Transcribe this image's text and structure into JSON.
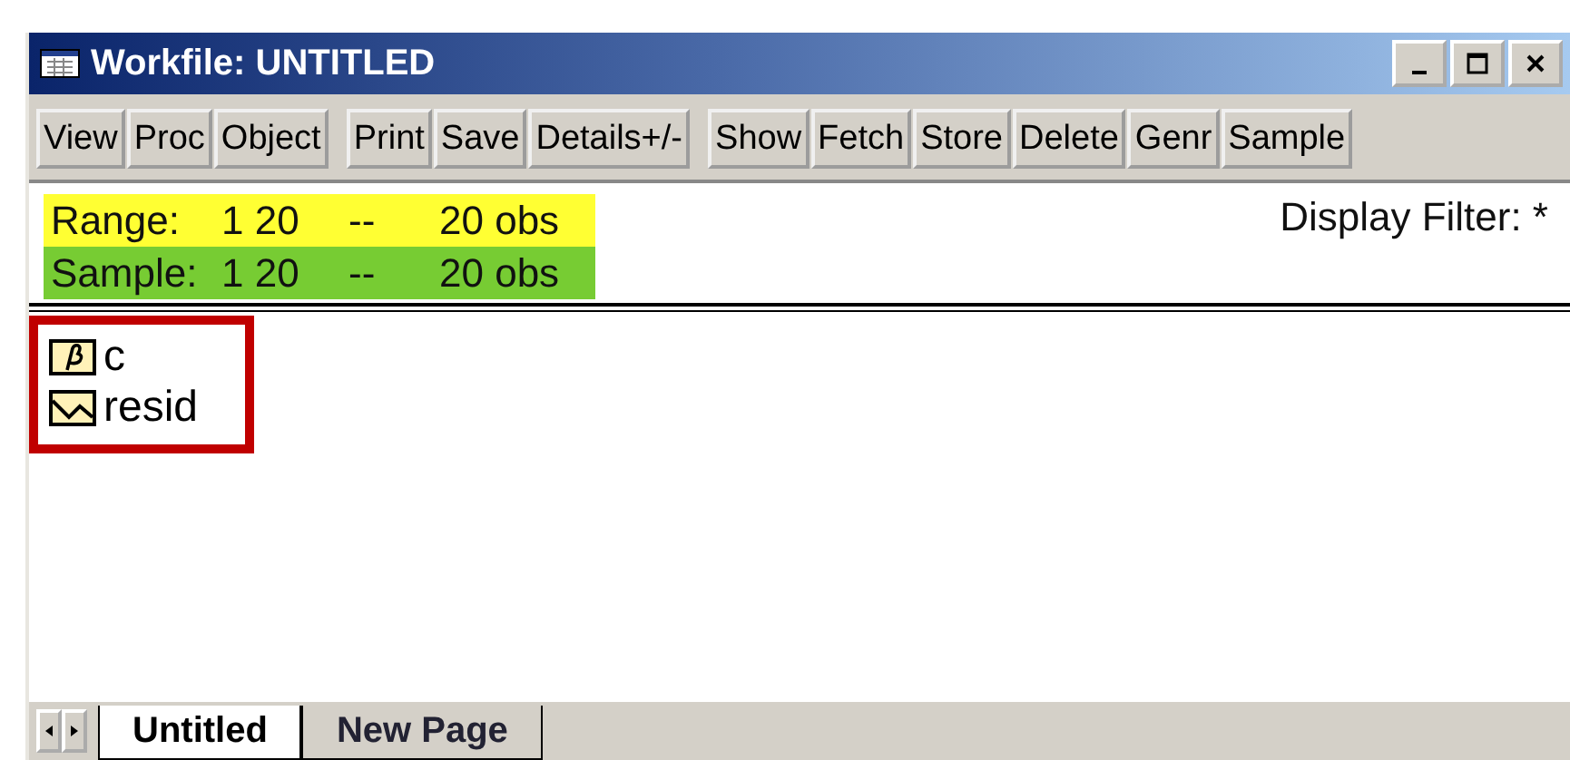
{
  "window": {
    "title": "Workfile: UNTITLED"
  },
  "toolbar": [
    [
      "View",
      "Proc",
      "Object"
    ],
    [
      "Print",
      "Save",
      "Details+/-"
    ],
    [
      "Show",
      "Fetch",
      "Store",
      "Delete",
      "Genr",
      "Sample"
    ]
  ],
  "info": [
    {
      "label": "Range:",
      "period": "1 20",
      "sep": "--",
      "obs": "20 obs",
      "color": "#ffff33"
    },
    {
      "label": "Sample:",
      "period": "1 20",
      "sep": "--",
      "obs": "20 obs",
      "color": "#77cc33"
    }
  ],
  "display_filter": "Display Filter: *",
  "objects": {
    "highlighted": true,
    "items": [
      {
        "kind": "coef",
        "name": "c"
      },
      {
        "kind": "series",
        "name": "resid"
      }
    ]
  },
  "tabs": [
    {
      "label": "Untitled",
      "selected": true
    },
    {
      "label": "New Page",
      "selected": false
    }
  ]
}
